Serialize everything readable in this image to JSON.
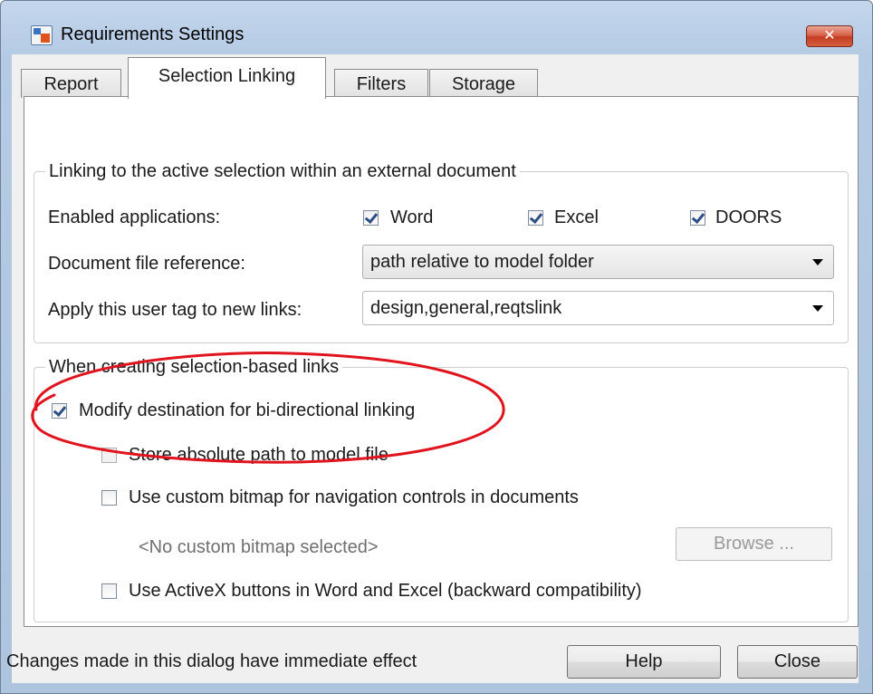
{
  "window": {
    "title": "Requirements Settings",
    "close_glyph": "✕"
  },
  "tabs": [
    {
      "label": "Report",
      "active": false
    },
    {
      "label": "Selection Linking",
      "active": true
    },
    {
      "label": "Filters",
      "active": false
    },
    {
      "label": "Storage",
      "active": false
    }
  ],
  "linking_group": {
    "title": "Linking to the active selection within an external document",
    "enabled_apps_label": "Enabled applications:",
    "apps": [
      {
        "label": "Word",
        "checked": true
      },
      {
        "label": "Excel",
        "checked": true
      },
      {
        "label": "DOORS",
        "checked": true
      }
    ],
    "doc_ref_label": "Document file reference:",
    "doc_ref_value": "path relative to model folder",
    "user_tag_label": "Apply this user tag to new links:",
    "user_tag_value": "design,general,reqtslink"
  },
  "creation_group": {
    "title": "When creating selection-based links",
    "modify_destination": {
      "label": "Modify destination for bi-directional linking",
      "checked": true
    },
    "store_absolute": {
      "label": "Store absolute path to model file",
      "checked": false,
      "enabled": false
    },
    "custom_bitmap": {
      "label": "Use custom bitmap for navigation controls in documents",
      "checked": false
    },
    "bitmap_status": "<No custom bitmap selected>",
    "browse_label": "Browse ...",
    "activex": {
      "label": "Use ActiveX buttons in Word and Excel (backward compatibility)",
      "checked": false
    }
  },
  "footer": {
    "note": "Changes made in this dialog have immediate effect",
    "help_label": "Help",
    "close_label": "Close"
  },
  "colors": {
    "annotation_ellipse": "#e0141e",
    "title_bar": "#b9cee7",
    "close_button": "#c9462c"
  }
}
